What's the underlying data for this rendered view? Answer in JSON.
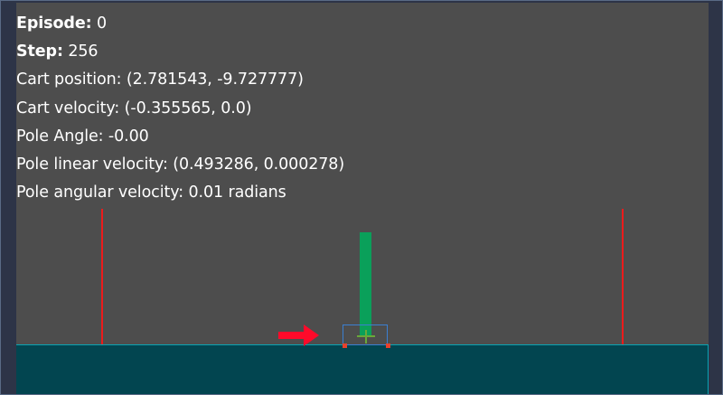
{
  "hud": {
    "episode_label": "Episode:",
    "episode_value": "0",
    "step_label": "Step:",
    "step_value": "256",
    "cart_position_label": "Cart position:",
    "cart_position_value": "(2.781543, -9.727777)",
    "cart_velocity_label": "Cart velocity:",
    "cart_velocity_value": "(-0.355565, 0.0)",
    "pole_angle_label": "Pole Angle:",
    "pole_angle_value": "-0.00",
    "pole_linear_velocity_label": "Pole linear velocity:",
    "pole_linear_velocity_value": "(0.493286, 0.000278)",
    "pole_angular_velocity_label": "Pole angular velocity:",
    "pole_angular_velocity_value": "0.01 radians"
  },
  "scene": {
    "background_color": "#4d4d4d",
    "ground_color": "#024550",
    "limit_line_color": "#ec1b1b",
    "pole_color": "#0aa05a",
    "push_arrow_direction": "right",
    "push_arrow_icon": "arrow-right-icon",
    "push_arrow_color": "#ff0a2a"
  }
}
